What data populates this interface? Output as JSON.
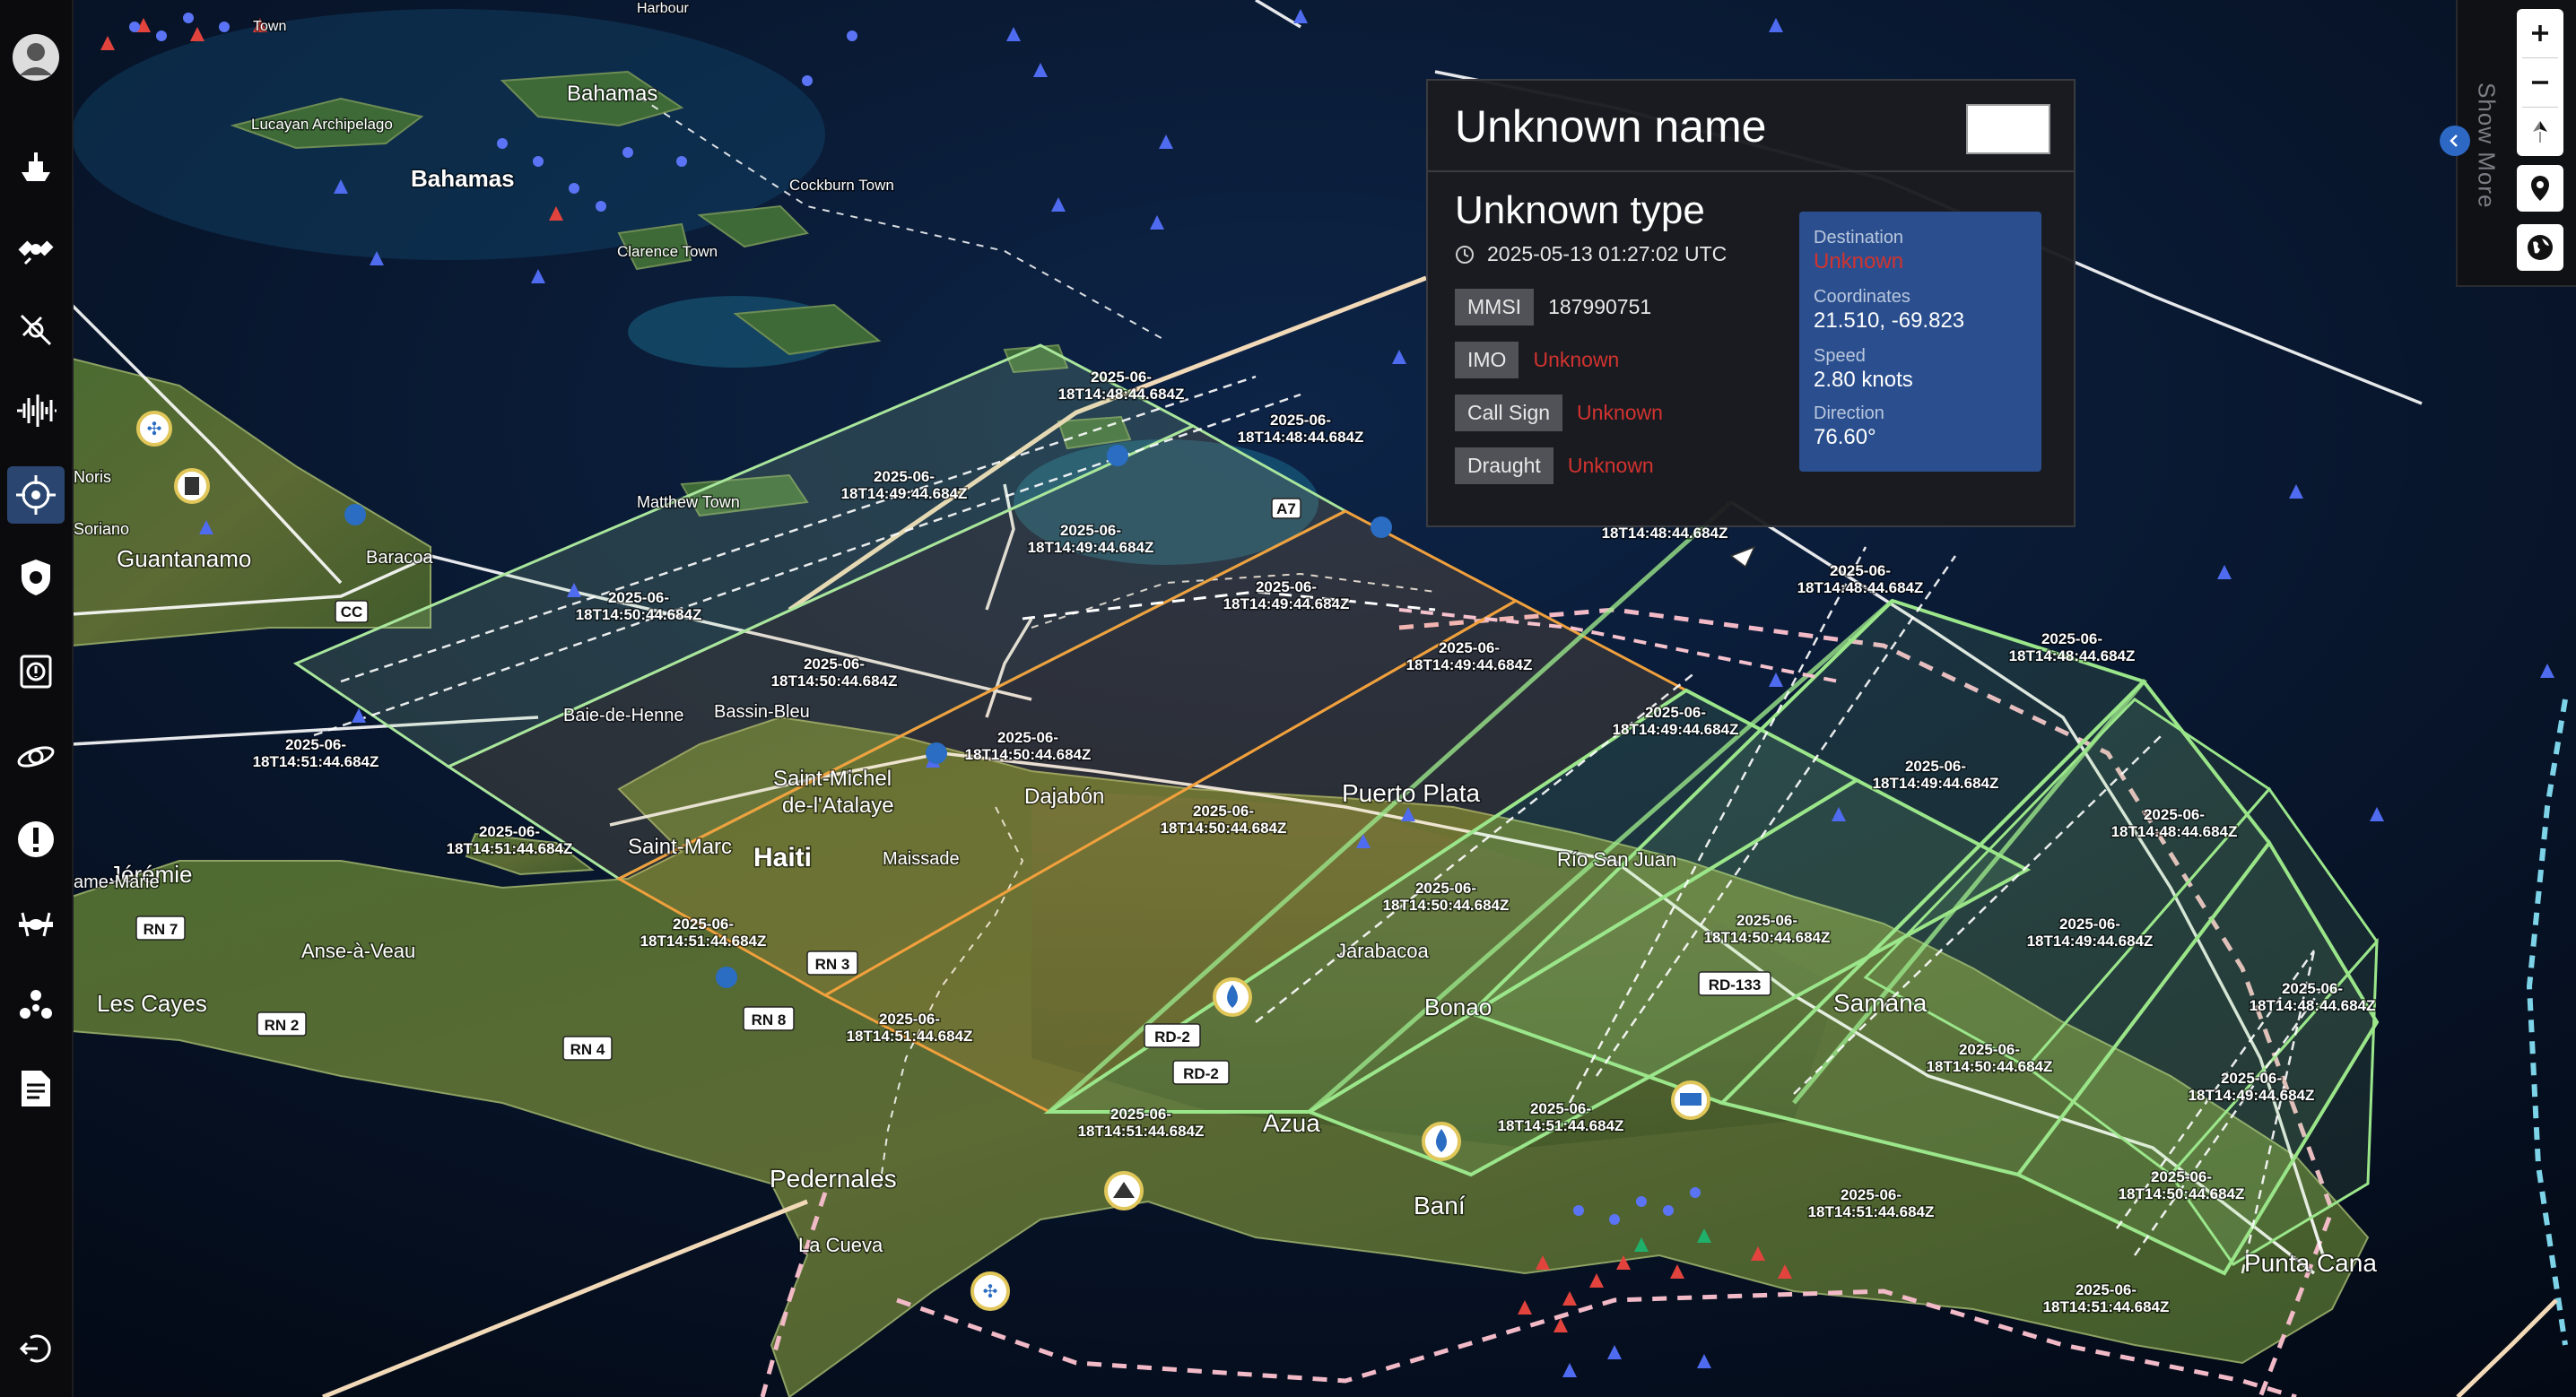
{
  "popup": {
    "title": "Unknown name",
    "type": "Unknown type",
    "timestamp": "2025-05-13 01:27:02 UTC",
    "properties": [
      {
        "label": "MMSI",
        "value": "187990751",
        "unknown": false
      },
      {
        "label": "IMO",
        "value": "Unknown",
        "unknown": true
      },
      {
        "label": "Call Sign",
        "value": "Unknown",
        "unknown": true
      },
      {
        "label": "Draught",
        "value": "Unknown",
        "unknown": true
      }
    ],
    "nav": {
      "destination_label": "Destination",
      "destination_value": "Unknown",
      "coordinates_label": "Coordinates",
      "coordinates_value": "21.510, -69.823",
      "speed_label": "Speed",
      "speed_value": "2.80 knots",
      "direction_label": "Direction",
      "direction_value": "76.60°"
    }
  },
  "right_panel": {
    "show_more": "Show More"
  },
  "sidebar": {
    "icons": [
      "user-avatar-icon",
      "ship-icon",
      "satellite-icon",
      "satellite-off-icon",
      "signal-wave-icon",
      "target-icon",
      "shield-icon",
      "alert-box-icon",
      "orbit-icon",
      "alert-circle-icon",
      "aircraft-icon",
      "drone-icon",
      "document-icon",
      "logout-icon"
    ],
    "active": "target-icon"
  },
  "map": {
    "place_labels": {
      "bahamas1": "Bahamas",
      "bahamas2": "Bahamas",
      "lucayan": "Lucayan Archipelago",
      "cockburn": "Cockburn Town",
      "clarence": "Clarence Town",
      "matthew": "Matthew Town",
      "guantanamo": "Guantanamo",
      "baracoa": "Baracoa",
      "noris": "Noris",
      "soriano": "Soriano",
      "baie": "Baie-de-Henne",
      "bassin": "Bassin-Bleu",
      "saintmichel1": "Saint-Michel",
      "saintmichel2": "de-l'Atalaye",
      "dajabon": "Dajabón",
      "puertoplata": "Puerto Plata",
      "saintmarc": "Saint-Marc",
      "haiti": "Haiti",
      "maissade": "Maissade",
      "riosanjuan": "Río San Juan",
      "jeremie": "Jérémie",
      "amemarie": "ame-Marie",
      "anseavaue": "Anse-à-Veau",
      "lescayes": "Les Cayes",
      "jarabacoa": "Jarabacoa",
      "bonao": "Bonao",
      "samana": "Samana",
      "azua": "Azua",
      "bani": "Baní",
      "pedernales": "Pedernales",
      "lacueva": "La Cueva",
      "puntacana": "Punta Cana",
      "town": "Town",
      "harbour": "Harbour"
    },
    "road_signs": [
      "RN 7",
      "RN 2",
      "RN 4",
      "RN 3",
      "RN 8",
      "CC",
      "RD-2",
      "RD-2",
      "RD-133",
      "A7"
    ],
    "timestamps": [
      {
        "d": "2025-06-",
        "t": "18T14:48:44.684Z"
      },
      {
        "d": "2025-06-",
        "t": "18T14:48:44.684Z"
      },
      {
        "d": "2025-06-",
        "t": "18T14:49:44.684Z"
      },
      {
        "d": "2025-06-",
        "t": "18T14:49:44.684Z"
      },
      {
        "d": "2025-06-",
        "t": "18T14:50:44.684Z"
      },
      {
        "d": "2025-06-",
        "t": "18T14:49:44.684Z"
      },
      {
        "d": "2025-06-",
        "t": "18T14:50:44.684Z"
      },
      {
        "d": "2025-06-",
        "t": "18T14:51:44.684Z"
      },
      {
        "d": "2025-06-",
        "t": "18T14:50:44.684Z"
      },
      {
        "d": "2025-06-",
        "t": "18T14:49:44.684Z"
      },
      {
        "d": "2025-06-",
        "t": "18T14:51:44.684Z"
      },
      {
        "d": "2025-06-",
        "t": "18T14:50:44.684Z"
      },
      {
        "d": "2025-06-",
        "t": "18T14:51:44.684Z"
      },
      {
        "d": "2025-06-",
        "t": "18T14:51:44.684Z"
      },
      {
        "d": "2025-06-",
        "t": "18T14:50:44.684Z"
      },
      {
        "d": "2025-06-",
        "t": "18T14:49:44.684Z"
      },
      {
        "d": "2025-06-",
        "t": "18T14:48:44.684Z"
      },
      {
        "d": "2025-06-",
        "t": "18T14:48:44.684Z"
      },
      {
        "d": "2025-06-",
        "t": "18T14:49:44.684Z"
      },
      {
        "d": "2025-06-",
        "t": "18T14:50:44.684Z"
      },
      {
        "d": "2025-06-",
        "t": "18T14:51:44.684Z"
      },
      {
        "d": "2025-06-",
        "t": "18T14:48:44.684Z"
      },
      {
        "d": "2025-06-",
        "t": "18T14:49:44.684Z"
      },
      {
        "d": "2025-06-",
        "t": "18T14:50:44.684Z"
      },
      {
        "d": "2025-06-",
        "t": "18T14:51:44.684Z"
      },
      {
        "d": "2025-06-",
        "t": "18T14:48:44.684Z"
      },
      {
        "d": "2025-06-",
        "t": "18T14:49:44.684Z"
      },
      {
        "d": "2025-06-",
        "t": "18T14:50:44.684Z"
      },
      {
        "d": "2025-06-",
        "t": "18T14:51:44.684Z"
      },
      {
        "d": "2025-06-",
        "t": "18T14:51:44.684Z"
      },
      {
        "d": "",
        "t": "18T14:48:44.684Z"
      }
    ],
    "colors": {
      "ocean": "#0a1a33",
      "land": "#3b5a2a",
      "footprint_green": "#9be68a",
      "footprint_orange": "#f0a03c",
      "unknown_red": "#d2332f",
      "nav_blue": "#2b4f8e"
    }
  }
}
